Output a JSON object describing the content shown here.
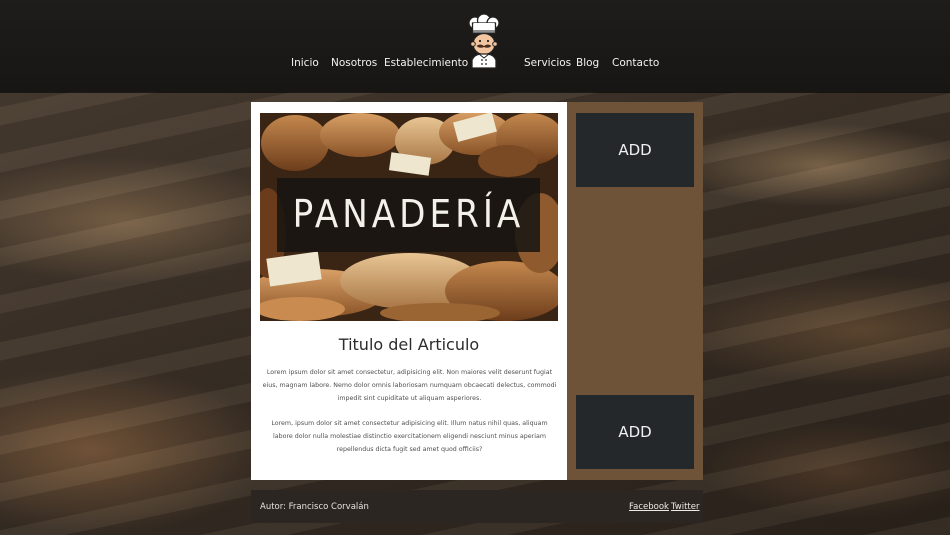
{
  "nav": {
    "left": [
      "Inicio",
      "Nosotros",
      "Establecimiento"
    ],
    "right": [
      "Servicios",
      "Blog",
      "Contacto"
    ]
  },
  "logo": {
    "icon": "chef-icon"
  },
  "hero": {
    "title": "PANADERÍA"
  },
  "article": {
    "title": "Titulo del Articulo",
    "paragraph1": "Lorem ipsum dolor sit amet consectetur, adipisicing elit. Non maiores velit deserunt fugiat eius, magnam labore. Nemo dolor omnis laboriosam numquam obcaecati delectus, commodi impedit sint cupiditate ut aliquam asperiores.",
    "paragraph2": "Lorem, ipsum dolor sit amet consectetur adipisicing elit. Illum natus nihil quas, aliquam labore dolor nulla molestiae distinctio exercitationem eligendi nesciunt minus aperiam repellendus dicta fugit sed amet quod officiis?"
  },
  "sidebar": {
    "ads": [
      "ADD",
      "ADD"
    ]
  },
  "footer": {
    "author": "Autor: Francisco Corvalán",
    "links": [
      "Facebook",
      "Twitter"
    ]
  },
  "colors": {
    "header_bg": "#1c1a18",
    "sidebar_bg": "#6f5339",
    "ad_bg": "#25282b",
    "footer_bg": "#2b2622"
  }
}
